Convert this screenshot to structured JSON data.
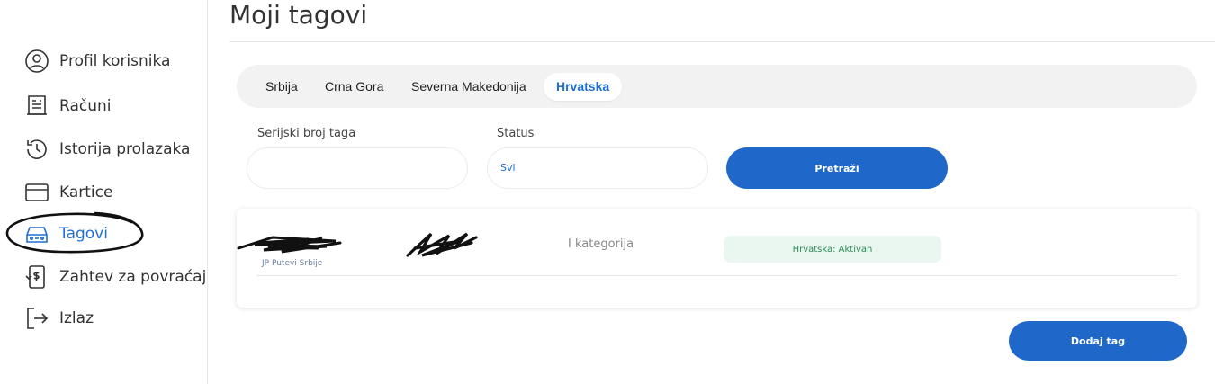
{
  "sidebar": {
    "items": [
      {
        "label": "Profil korisnika",
        "icon": "user-circle-icon"
      },
      {
        "label": "Računi",
        "icon": "receipt-icon"
      },
      {
        "label": "Istorija prolazaka",
        "icon": "history-icon"
      },
      {
        "label": "Kartice",
        "icon": "credit-card-icon"
      },
      {
        "label": "Tagovi",
        "icon": "car-icon",
        "active": true
      },
      {
        "label": "Zahtev za povraćaj",
        "icon": "refund-icon"
      },
      {
        "label": "Izlaz",
        "icon": "logout-icon"
      }
    ]
  },
  "page": {
    "title": "Moji tagovi"
  },
  "tabs": [
    {
      "label": "Srbija"
    },
    {
      "label": "Crna Gora"
    },
    {
      "label": "Severna Makedonija"
    },
    {
      "label": "Hrvatska",
      "active": true
    }
  ],
  "filters": {
    "serial_label": "Serijski broj taga",
    "serial_value": "",
    "status_label": "Status",
    "status_value": "Svi",
    "search_button": "Pretraži"
  },
  "tag_row": {
    "issuer": "JP Putevi Srbije",
    "category": "I kategorija",
    "status": "Hrvatska: Aktivan"
  },
  "actions": {
    "add_tag": "Dodaj tag"
  },
  "colors": {
    "accent": "#1f6fd6",
    "button": "#1f68c9",
    "status_bg": "#eaf7f0",
    "status_text": "#2e8a57"
  }
}
